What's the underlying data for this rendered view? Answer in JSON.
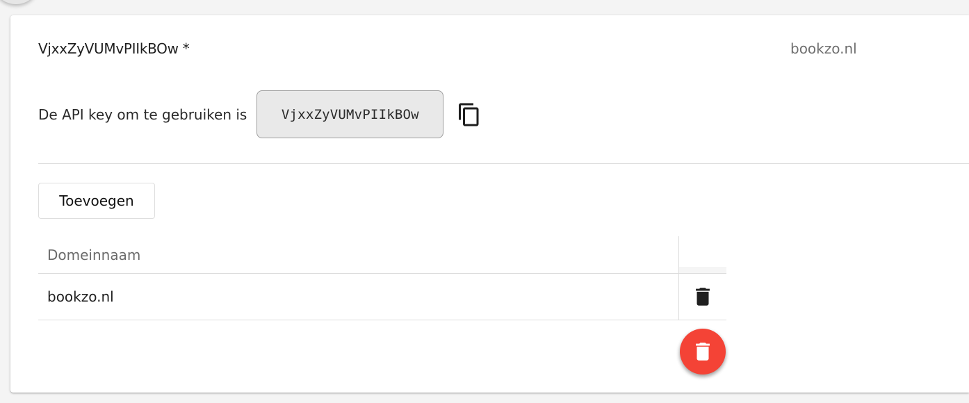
{
  "card": {
    "key_title": "VjxxZyVUMvPIIkBOw *",
    "domain_summary": "bookzo.nl"
  },
  "api": {
    "label": "De API key om te gebruiken is",
    "key_value": "VjxxZyVUMvPIIkBOw",
    "copy_icon": "copy-icon"
  },
  "actions": {
    "add_label": "Toevoegen"
  },
  "table": {
    "columns": [
      "Domeinnaam"
    ],
    "rows": [
      {
        "domain": "bookzo.nl",
        "action_icon": "delete-icon"
      }
    ]
  },
  "fab": {
    "icon": "delete-icon",
    "color": "#f44336"
  }
}
